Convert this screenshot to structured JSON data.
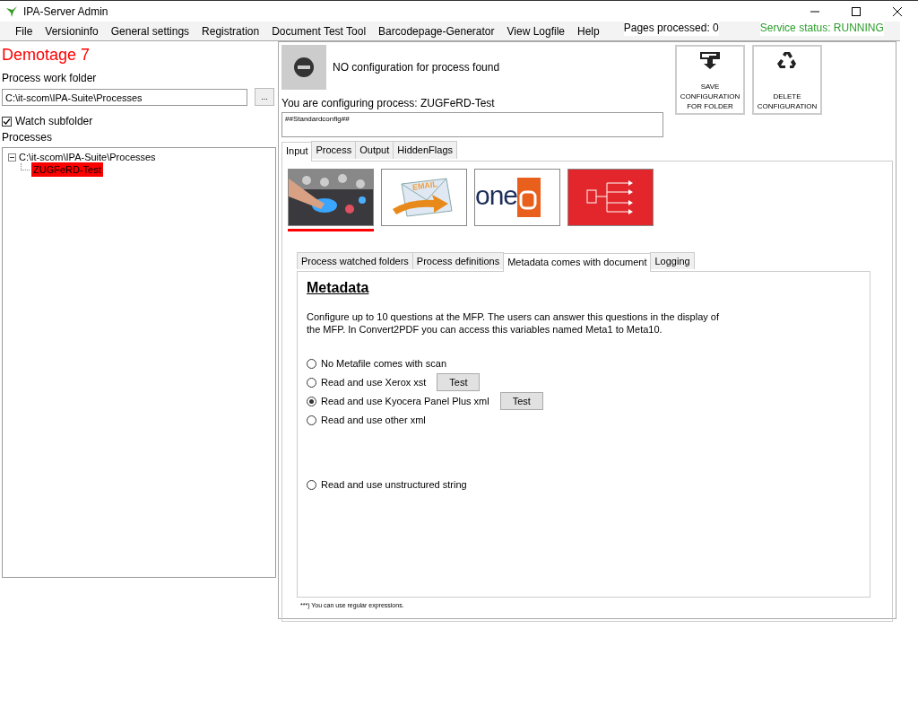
{
  "window": {
    "title": "IPA-Server Admin"
  },
  "menu": [
    "File",
    "Versioninfo",
    "General  settings",
    "Registration",
    "Document Test Tool",
    "Barcodepage-Generator",
    "View Logfile",
    "Help"
  ],
  "status": {
    "pages": "Pages processed: 0",
    "service": "Service status: RUNNING"
  },
  "left": {
    "heading": "Demotage 7",
    "folder_label": "Process work folder",
    "folder_value": "C:\\it-scom\\IPA-Suite\\Processes",
    "browse": "...",
    "watch": {
      "label": "Watch subfolder",
      "checked": true
    },
    "processes_label": "Processes",
    "tree": [
      {
        "label": "C:\\it-scom\\IPA-Suite\\Processes",
        "expanded": true,
        "selected": false,
        "children": [
          {
            "label": "ZUGFeRD-Test",
            "selected": true
          }
        ]
      }
    ]
  },
  "config": {
    "message": "NO configuration for process found",
    "configuring": "You are configuring process: ZUGFeRD-Test",
    "config_text": "##Standardconfig##"
  },
  "actions": [
    {
      "kind": "save",
      "label": "SAVE CONFIGURATION FOR FOLDER"
    },
    {
      "kind": "delete",
      "label": "DELETE CONFIGURATION"
    }
  ],
  "tabs": [
    {
      "label": "Input",
      "selected": true
    },
    {
      "label": "Process",
      "selected": false
    },
    {
      "label": "Output",
      "selected": false
    },
    {
      "label": "HiddenFlags",
      "selected": false
    }
  ],
  "sources": [
    {
      "kind": "picture",
      "selected": true
    },
    {
      "kind": "email",
      "text": "EMAIL",
      "selected": false
    },
    {
      "kind": "logo",
      "text": "one",
      "selected": false
    },
    {
      "kind": "flow",
      "selected": false
    }
  ],
  "subtabs": [
    {
      "label": "Process watched folders",
      "selected": false
    },
    {
      "label": "Process definitions",
      "selected": false
    },
    {
      "label": "Metadata comes with document",
      "selected": true
    },
    {
      "label": "Logging",
      "selected": false
    }
  ],
  "metadata": {
    "title": "Metadata",
    "description": "Configure up to 10 questions at the MFP. The users can answer this questions in the display of the MFP. In Convert2PDF you can access this variables named Meta1 to Meta10.",
    "options": [
      {
        "label": "No Metafile comes with scan",
        "selected": false
      },
      {
        "label": "Read and use Xerox xst",
        "selected": false,
        "button": "Test"
      },
      {
        "label": "Read and use Kyocera Panel Plus xml",
        "selected": true,
        "button": "Test"
      },
      {
        "label": "Read and use other xml",
        "selected": false
      }
    ],
    "more_options": [
      {
        "label": "Read and use unstructured string",
        "selected": false
      }
    ]
  },
  "footnote": "***) You can use regular expressions."
}
